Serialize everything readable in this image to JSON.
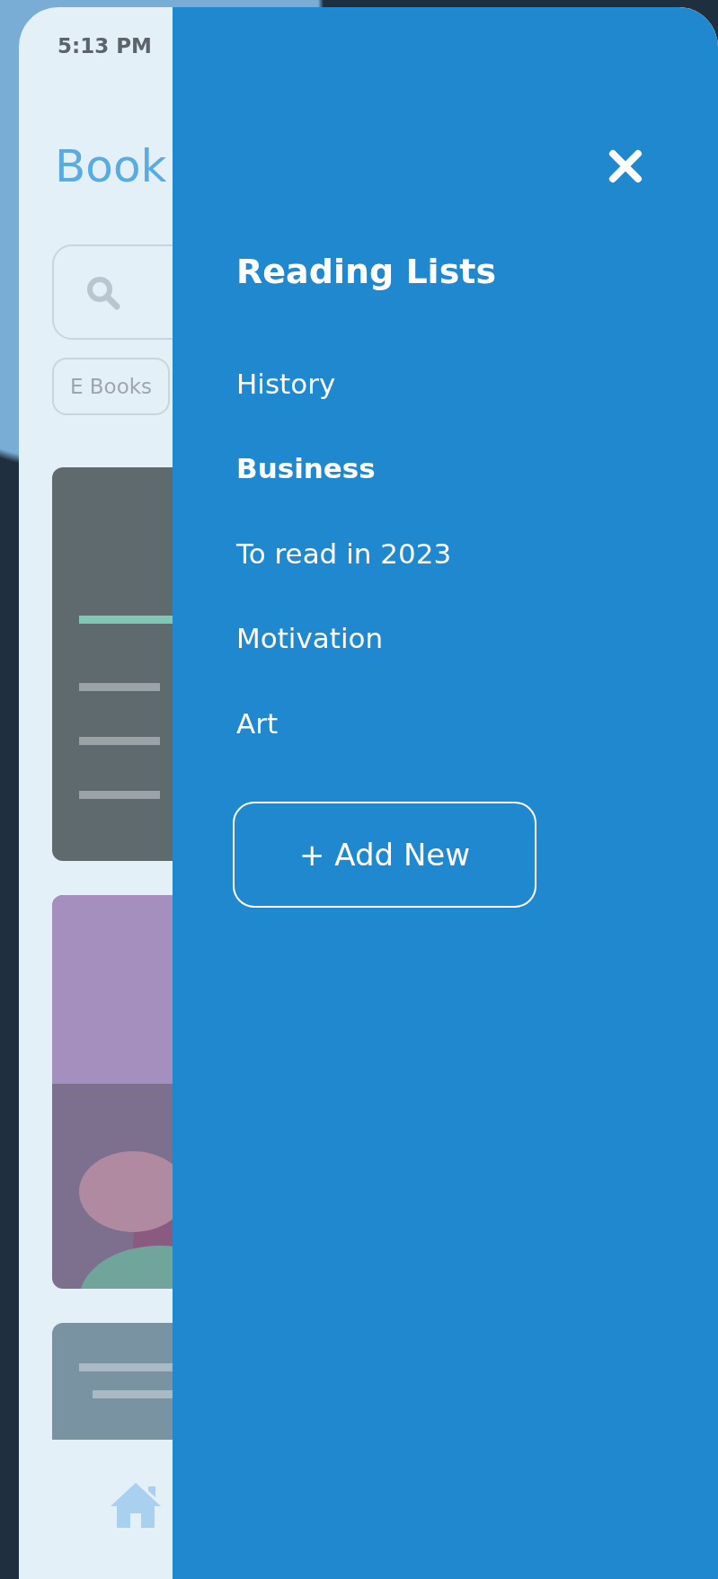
{
  "status_bar": {
    "time": "5:13 PM"
  },
  "page": {
    "title": "Book"
  },
  "filters": [
    {
      "label": "E Books"
    }
  ],
  "drawer": {
    "title": "Reading Lists",
    "items": [
      {
        "label": "History",
        "selected": false
      },
      {
        "label": "Business",
        "selected": true
      },
      {
        "label": "To read in 2023",
        "selected": false
      },
      {
        "label": "Motivation",
        "selected": false
      },
      {
        "label": "Art",
        "selected": false
      }
    ],
    "add_button": "+ Add New"
  }
}
